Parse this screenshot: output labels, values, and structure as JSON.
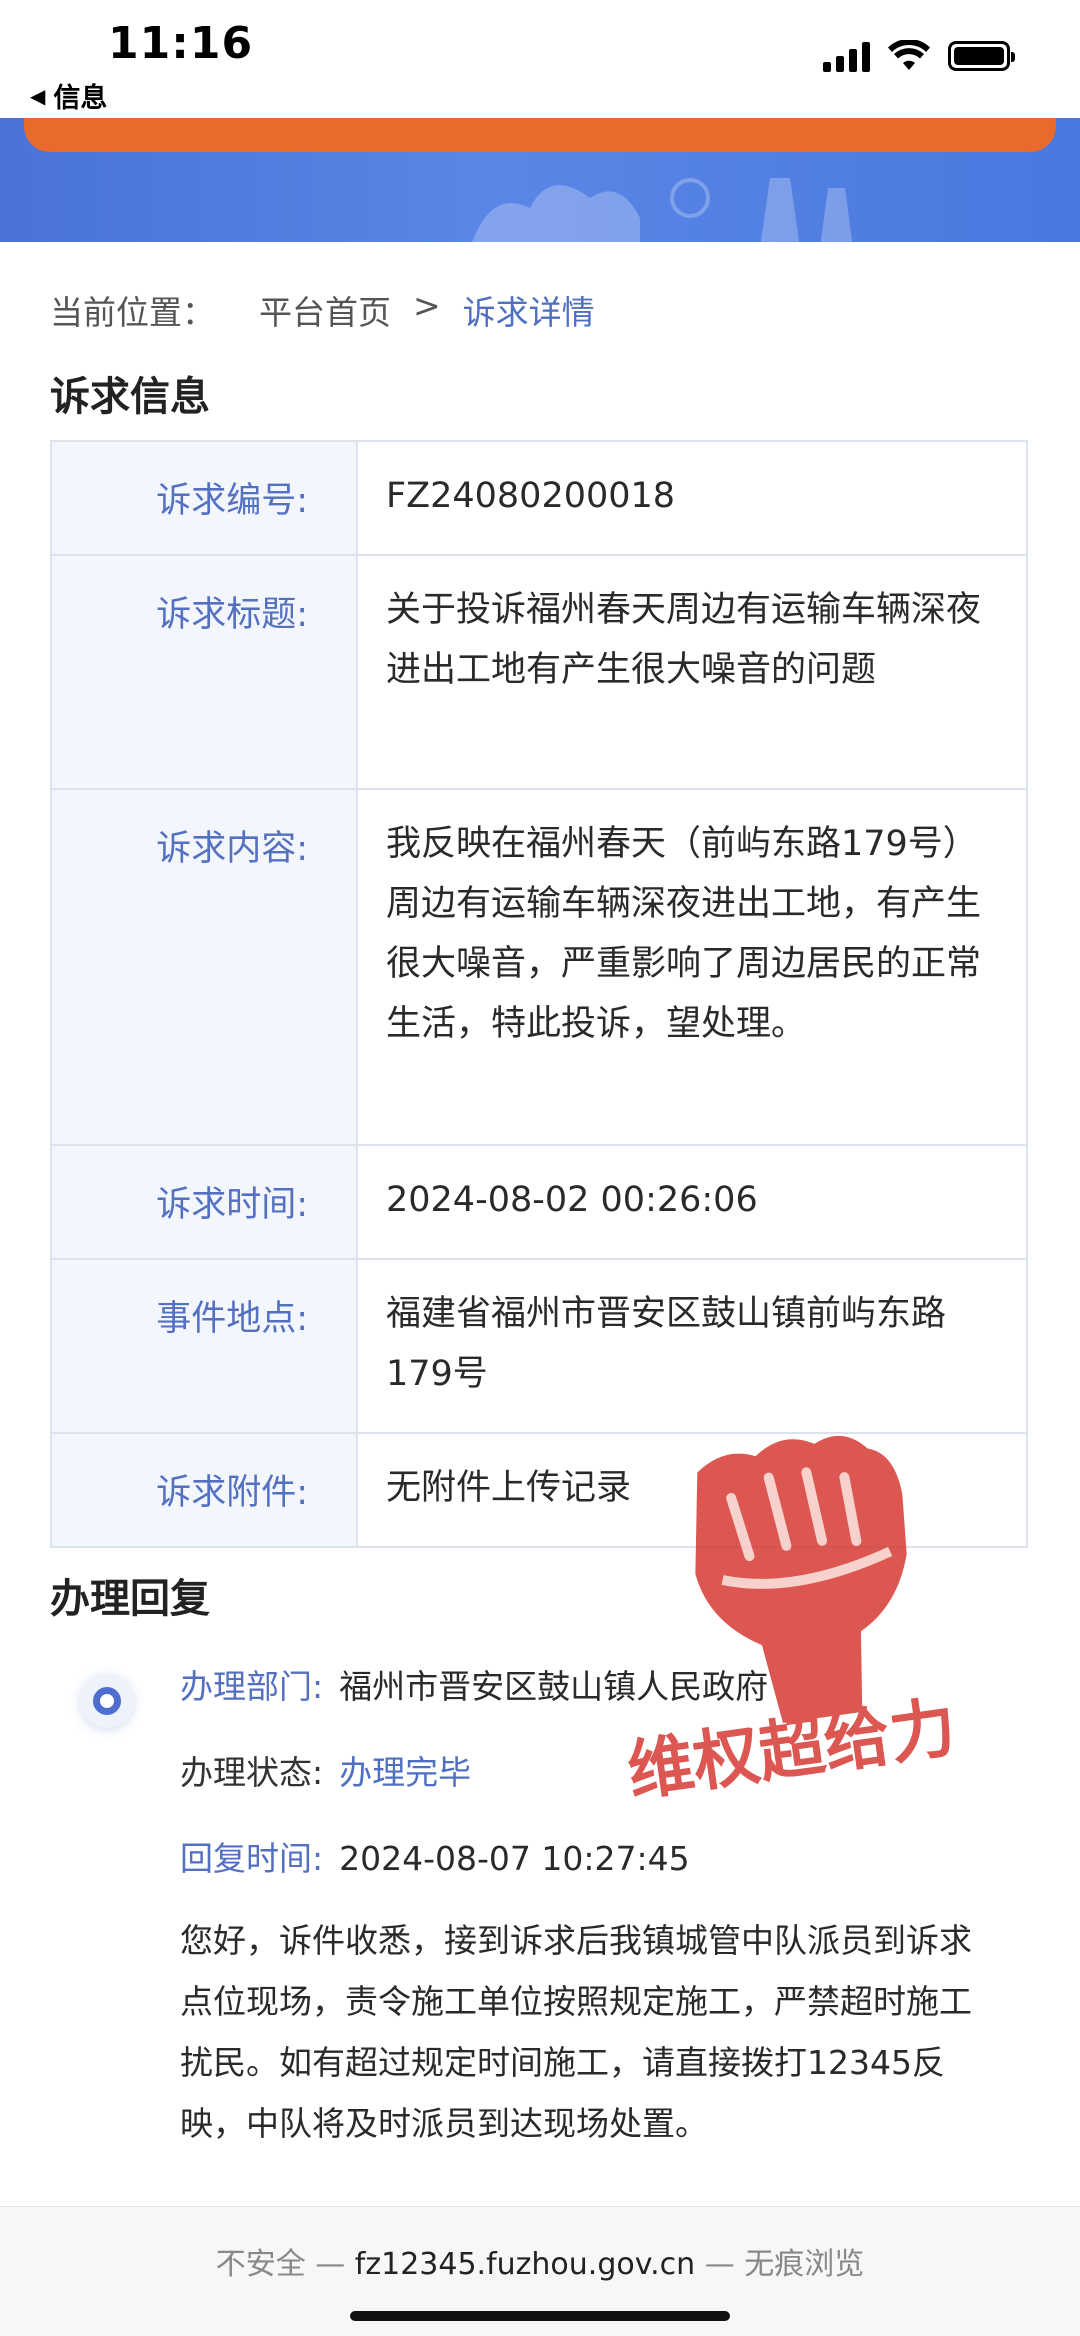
{
  "status_bar": {
    "time": "11:16",
    "back_app": "信息",
    "back_glyph": "◀"
  },
  "breadcrumb": {
    "label": "当前位置：",
    "home": "平台首页",
    "separator": ">",
    "current": "诉求详情"
  },
  "info": {
    "title": "诉求信息",
    "rows": [
      {
        "label": "诉求编号:",
        "value": "FZ24080200018"
      },
      {
        "label": "诉求标题:",
        "value": "关于投诉福州春天周边有运输车辆深夜进出工地有产生很大噪音的问题"
      },
      {
        "label": "诉求内容:",
        "value": "我反映在福州春天（前屿东路179号）周边有运输车辆深夜进出工地，有产生很大噪音，严重影响了周边居民的正常生活，特此投诉，望处理。"
      },
      {
        "label": "诉求时间:",
        "value": "2024-08-02 00:26:06"
      },
      {
        "label": "事件地点:",
        "value": "福建省福州市晋安区鼓山镇前屿东路179号"
      },
      {
        "label": "诉求附件:",
        "value": "无附件上传记录"
      }
    ]
  },
  "reply": {
    "title": "办理回复",
    "department_label": "办理部门:",
    "department": "福州市晋安区鼓山镇人民政府",
    "status_label": "办理状态:",
    "status": "办理完毕",
    "time_label": "回复时间:",
    "time": "2024-08-07 10:27:45",
    "content": "您好，诉件收悉，接到诉求后我镇城管中队派员到诉求点位现场，责令施工单位按照规定施工，严禁超时施工扰民。如有超过规定时间施工，请直接拨打12345反映，中队将及时派员到达现场处置。"
  },
  "watermark": {
    "text": "维权超给力",
    "color": "#d63a34"
  },
  "url_bar": {
    "prefix": "不安全 —",
    "domain": "fz12345.fuzhou.gov.cn",
    "suffix": "— 无痕浏览"
  },
  "colors": {
    "accent_blue": "#4f6fc0",
    "banner_blue": "#5a86e6",
    "banner_orange": "#ea6a2c"
  }
}
